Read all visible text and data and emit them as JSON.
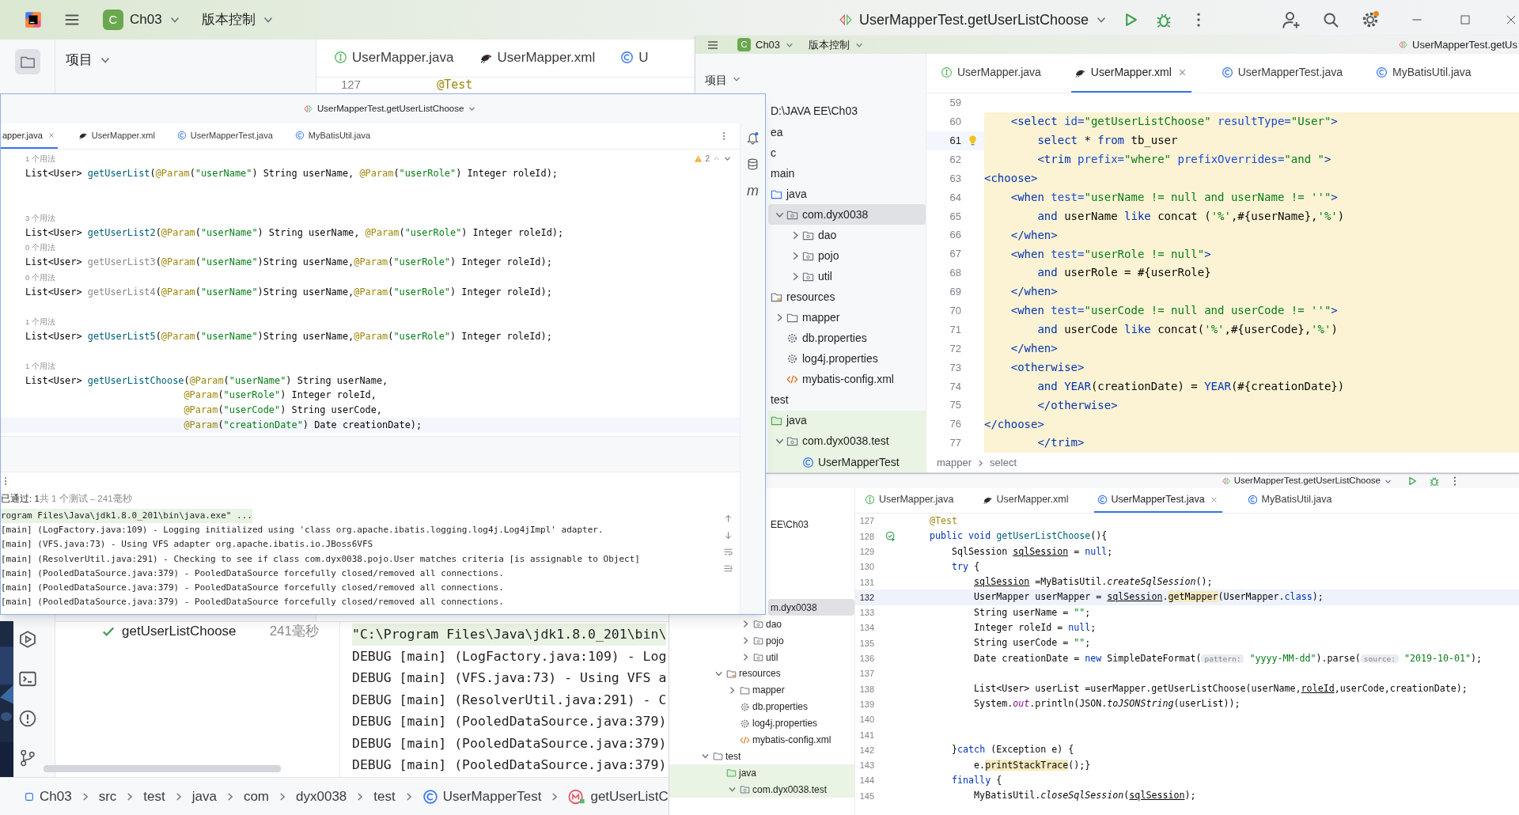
{
  "main_window": {
    "toolbar": {
      "project_badge": "C",
      "project": "Ch03",
      "vcs": "版本控制",
      "run_config": "UserMapperTest.getUserListChoose"
    },
    "project_panel": {
      "title": "项目"
    },
    "tabs": [
      {
        "label": "UserMapper.java",
        "kind": "interface",
        "selected": false
      },
      {
        "label": "UserMapper.xml",
        "kind": "xml",
        "selected": false
      },
      {
        "label": "U",
        "kind": "class",
        "selected": false
      }
    ],
    "lines": [
      {
        "number": "127",
        "current": false,
        "segs": [
          {
            "text": "    @Test",
            "kind": "a"
          }
        ]
      }
    ],
    "test_tree": [
      {
        "name": "getUserListChoose",
        "passed": true,
        "time": "241毫秒"
      }
    ],
    "console": [
      {
        "kind": "command",
        "text": "\"C:\\Program Files\\Java\\jdk1.8.0_201\\bin\\"
      },
      {
        "kind": "log",
        "text": "DEBUG [main] (LogFactory.java:109) - Log"
      },
      {
        "kind": "log",
        "text": "DEBUG [main] (VFS.java:73) - Using VFS a"
      },
      {
        "kind": "log",
        "text": "DEBUG [main] (ResolverUtil.java:291) - C"
      },
      {
        "kind": "log",
        "text": "DEBUG [main] (PooledDataSource.java:379)"
      },
      {
        "kind": "log",
        "text": "DEBUG [main] (PooledDataSource.java:379)"
      },
      {
        "kind": "log",
        "text": "DEBUG [main] (PooledDataSource.java:379)"
      }
    ],
    "breadcrumbs": [
      {
        "label": "Ch03",
        "kind": "module"
      },
      {
        "label": "src",
        "kind": "plain"
      },
      {
        "label": "test",
        "kind": "plain"
      },
      {
        "label": "java",
        "kind": "plain"
      },
      {
        "label": "com",
        "kind": "plain"
      },
      {
        "label": "dyx0038",
        "kind": "plain"
      },
      {
        "label": "test",
        "kind": "plain"
      },
      {
        "label": "UserMapperTest",
        "kind": "class"
      },
      {
        "label": "getUserListC",
        "kind": "method"
      }
    ]
  },
  "editor_window_left": {
    "run_config": "UserMapperTest.getUserListChoose",
    "tabs": [
      {
        "label": "apper.java",
        "kind": "none",
        "selected": true
      },
      {
        "label": "UserMapper.xml",
        "kind": "xml",
        "selected": false
      },
      {
        "label": "UserMapperTest.java",
        "kind": "class",
        "selected": false
      },
      {
        "label": "MyBatisUtil.java",
        "kind": "class",
        "selected": false
      }
    ],
    "inspections": "2",
    "maven_glyph": "m",
    "lines": [
      {
        "kind": "hint",
        "text": "1 个用法"
      },
      {
        "kind": "code",
        "current": false,
        "segs": [
          {
            "text": "List<User> ",
            "kind": "p"
          },
          {
            "text": "getUserList",
            "kind": "m"
          },
          {
            "text": "(",
            "kind": "p"
          },
          {
            "text": "@Param",
            "kind": "a"
          },
          {
            "text": "(",
            "kind": "p"
          },
          {
            "text": "\"userName\"",
            "kind": "s"
          },
          {
            "text": ") String userName, ",
            "kind": "p"
          },
          {
            "text": "@Param",
            "kind": "a"
          },
          {
            "text": "(",
            "kind": "p"
          },
          {
            "text": "\"userRole\"",
            "kind": "s"
          },
          {
            "text": ") Integer roleId);",
            "kind": "p"
          }
        ]
      },
      {
        "kind": "blank"
      },
      {
        "kind": "blank"
      },
      {
        "kind": "hint",
        "text": "3 个用法"
      },
      {
        "kind": "code",
        "current": false,
        "segs": [
          {
            "text": "List<User> ",
            "kind": "p"
          },
          {
            "text": "getUserList2",
            "kind": "m"
          },
          {
            "text": "(",
            "kind": "p"
          },
          {
            "text": "@Param",
            "kind": "a"
          },
          {
            "text": "(",
            "kind": "p"
          },
          {
            "text": "\"userName\"",
            "kind": "s"
          },
          {
            "text": ") String userName, ",
            "kind": "p"
          },
          {
            "text": "@Param",
            "kind": "a"
          },
          {
            "text": "(",
            "kind": "p"
          },
          {
            "text": "\"userRole\"",
            "kind": "s"
          },
          {
            "text": ") Integer roleId);",
            "kind": "p"
          }
        ]
      },
      {
        "kind": "hint",
        "text": "0 个用法"
      },
      {
        "kind": "code",
        "current": false,
        "segs": [
          {
            "text": "List<User> ",
            "kind": "p"
          },
          {
            "text": "getUserList3",
            "kind": "u"
          },
          {
            "text": "(",
            "kind": "p"
          },
          {
            "text": "@Param",
            "kind": "a"
          },
          {
            "text": "(",
            "kind": "p"
          },
          {
            "text": "\"userName\"",
            "kind": "s"
          },
          {
            "text": ")String userName,",
            "kind": "p"
          },
          {
            "text": "@Param",
            "kind": "a"
          },
          {
            "text": "(",
            "kind": "p"
          },
          {
            "text": "\"userRole\"",
            "kind": "s"
          },
          {
            "text": ") Integer roleId);",
            "kind": "p"
          }
        ]
      },
      {
        "kind": "hint",
        "text": "0 个用法"
      },
      {
        "kind": "code",
        "current": false,
        "segs": [
          {
            "text": "List<User> ",
            "kind": "p"
          },
          {
            "text": "getUserList4",
            "kind": "u"
          },
          {
            "text": "(",
            "kind": "p"
          },
          {
            "text": "@Param",
            "kind": "a"
          },
          {
            "text": "(",
            "kind": "p"
          },
          {
            "text": "\"userName\"",
            "kind": "s"
          },
          {
            "text": ")String userName,",
            "kind": "p"
          },
          {
            "text": "@Param",
            "kind": "a"
          },
          {
            "text": "(",
            "kind": "p"
          },
          {
            "text": "\"userRole\"",
            "kind": "s"
          },
          {
            "text": ") Integer roleId);",
            "kind": "p"
          }
        ]
      },
      {
        "kind": "blank"
      },
      {
        "kind": "hint",
        "text": "1 个用法"
      },
      {
        "kind": "code",
        "current": false,
        "segs": [
          {
            "text": "List<User> ",
            "kind": "p"
          },
          {
            "text": "getUserList5",
            "kind": "m"
          },
          {
            "text": "(",
            "kind": "p"
          },
          {
            "text": "@Param",
            "kind": "a"
          },
          {
            "text": "(",
            "kind": "p"
          },
          {
            "text": "\"userName\"",
            "kind": "s"
          },
          {
            "text": ")String userName,",
            "kind": "p"
          },
          {
            "text": "@Param",
            "kind": "a"
          },
          {
            "text": "(",
            "kind": "p"
          },
          {
            "text": "\"userRole\"",
            "kind": "s"
          },
          {
            "text": ") Integer roleId);",
            "kind": "p"
          }
        ]
      },
      {
        "kind": "blank"
      },
      {
        "kind": "hint",
        "text": "1 个用法"
      },
      {
        "kind": "code",
        "current": false,
        "segs": [
          {
            "text": "List<User> ",
            "kind": "p"
          },
          {
            "text": "getUserListChoose",
            "kind": "m"
          },
          {
            "text": "(",
            "kind": "p"
          },
          {
            "text": "@Param",
            "kind": "a"
          },
          {
            "text": "(",
            "kind": "p"
          },
          {
            "text": "\"userName\"",
            "kind": "s"
          },
          {
            "text": ") String userName,",
            "kind": "p"
          }
        ]
      },
      {
        "kind": "code",
        "current": false,
        "segs": [
          {
            "text": "                            @Param",
            "kind": "a"
          },
          {
            "text": "(",
            "kind": "p"
          },
          {
            "text": "\"userRole\"",
            "kind": "s"
          },
          {
            "text": ") Integer roleId,",
            "kind": "p"
          }
        ]
      },
      {
        "kind": "code",
        "current": false,
        "segs": [
          {
            "text": "                            @Param",
            "kind": "a"
          },
          {
            "text": "(",
            "kind": "p"
          },
          {
            "text": "\"userCode\"",
            "kind": "s"
          },
          {
            "text": ") String userCode,",
            "kind": "p"
          }
        ]
      },
      {
        "kind": "code",
        "current": true,
        "segs": [
          {
            "text": "                            @Param",
            "kind": "a"
          },
          {
            "text": "(",
            "kind": "p"
          },
          {
            "text": "\"creationDate\"",
            "kind": "s"
          },
          {
            "text": ") Date creationDate);",
            "kind": "p"
          }
        ]
      }
    ],
    "test_status": {
      "passed": "已通过: 1",
      "summary": "共 1 个测试 – 241毫秒"
    },
    "console": [
      {
        "kind": "command",
        "text": "rogram Files\\Java\\jdk1.8.0_201\\bin\\java.exe\" ..."
      },
      {
        "kind": "log",
        "text": "[main] (LogFactory.java:109) - Logging initialized using 'class org.apache.ibatis.logging.log4j.Log4jImpl' adapter."
      },
      {
        "kind": "log",
        "text": "[main] (VFS.java:73) - Using VFS adapter org.apache.ibatis.io.JBoss6VFS"
      },
      {
        "kind": "log",
        "text": "[main] (ResolverUtil.java:291) - Checking to see if class com.dyx0038.pojo.User matches criteria [is assignable to Object]"
      },
      {
        "kind": "log",
        "text": "[main] (PooledDataSource.java:379) - PooledDataSource forcefully closed/removed all connections."
      },
      {
        "kind": "log",
        "text": "[main] (PooledDataSource.java:379) - PooledDataSource forcefully closed/removed all connections."
      },
      {
        "kind": "log",
        "text": "[main] (PooledDataSource.java:379) - PooledDataSource forcefully closed/removed all connections."
      }
    ]
  },
  "editor_window_right": {
    "toolbar": {
      "project_badge": "C",
      "project": "Ch03",
      "vcs": "版本控制",
      "run_config": "UserMapperTest.getUs"
    },
    "project_panel": {
      "title": "项目"
    },
    "tree": [
      {
        "label": "D:\\JAVA EE\\Ch03",
        "selected": false,
        "children": [
          {
            "label": "ea",
            "selected": false
          },
          {
            "label": "c",
            "selected": false,
            "children": [
              {
                "label": "main",
                "selected": false,
                "children": [
                  {
                    "label": "java",
                    "kind": "source",
                    "selected": false,
                    "children": [
                      {
                        "label": "com.dyx0038",
                        "kind": "package",
                        "selected": true,
                        "expanded": true,
                        "children": [
                          {
                            "label": "dao",
                            "kind": "package",
                            "selected": false,
                            "expanded": false
                          },
                          {
                            "label": "pojo",
                            "kind": "package",
                            "selected": false,
                            "expanded": false
                          },
                          {
                            "label": "util",
                            "kind": "package",
                            "selected": false,
                            "expanded": false
                          }
                        ]
                      }
                    ]
                  },
                  {
                    "label": "resources",
                    "kind": "resources",
                    "selected": false,
                    "children": [
                      {
                        "label": "mapper",
                        "kind": "folder",
                        "selected": false,
                        "expanded": false
                      },
                      {
                        "label": "db.properties",
                        "kind": "properties",
                        "selected": false
                      },
                      {
                        "label": "log4j.properties",
                        "kind": "properties",
                        "selected": false
                      },
                      {
                        "label": "mybatis-config.xml",
                        "kind": "xml",
                        "selected": false
                      }
                    ]
                  }
                ]
              },
              {
                "label": "test",
                "selected": false,
                "children": [
                  {
                    "label": "java",
                    "kind": "test_source",
                    "selected": false,
                    "children": [
                      {
                        "label": "com.dyx0038.test",
                        "kind": "package",
                        "selected": false,
                        "expanded": true,
                        "children": [
                          {
                            "label": "UserMapperTest",
                            "kind": "class",
                            "selected": false
                          }
                        ]
                      }
                    ]
                  }
                ]
              }
            ]
          }
        ]
      }
    ],
    "tabs": [
      {
        "label": "UserMapper.java",
        "kind": "interface",
        "selected": false
      },
      {
        "label": "UserMapper.xml",
        "kind": "xml",
        "selected": true
      },
      {
        "label": "UserMapperTest.java",
        "kind": "class",
        "selected": false
      },
      {
        "label": "MyBatisUtil.java",
        "kind": "class",
        "selected": false
      }
    ],
    "lines": [
      {
        "number": "59",
        "current": false,
        "highlighted": false
      },
      {
        "number": "60",
        "current": false,
        "highlighted": true,
        "segs": [
          {
            "text": "    <select",
            "kind": "x"
          },
          {
            "text": " id=",
            "kind": "n"
          },
          {
            "text": "\"getUserListChoose\"",
            "kind": "s"
          },
          {
            "text": " resultType=",
            "kind": "n"
          },
          {
            "text": "\"User\"",
            "kind": "s"
          },
          {
            "text": ">",
            "kind": "x"
          }
        ]
      },
      {
        "number": "61",
        "current": true,
        "highlighted": true,
        "gutter": {
          "kind": "bulb"
        },
        "segs": [
          {
            "text": "        select",
            "kind": "k"
          },
          {
            "text": " * ",
            "kind": "p"
          },
          {
            "text": "from",
            "kind": "k"
          },
          {
            "text": " tb_user",
            "kind": "p"
          }
        ]
      },
      {
        "number": "62",
        "current": false,
        "highlighted": true,
        "segs": [
          {
            "text": "        <trim",
            "kind": "x"
          },
          {
            "text": " prefix=",
            "kind": "n"
          },
          {
            "text": "\"where\"",
            "kind": "s"
          },
          {
            "text": " prefixOverrides=",
            "kind": "n"
          },
          {
            "text": "\"and \"",
            "kind": "s"
          },
          {
            "text": ">",
            "kind": "x"
          }
        ]
      },
      {
        "number": "63",
        "current": false,
        "highlighted": true,
        "segs": [
          {
            "text": "<choose>",
            "kind": "x"
          }
        ]
      },
      {
        "number": "64",
        "current": false,
        "highlighted": true,
        "segs": [
          {
            "text": "    <when",
            "kind": "x"
          },
          {
            "text": " test=",
            "kind": "n"
          },
          {
            "text": "\"userName != null and userName != ''\"",
            "kind": "s"
          },
          {
            "text": ">",
            "kind": "x"
          }
        ]
      },
      {
        "number": "65",
        "current": false,
        "highlighted": true,
        "segs": [
          {
            "text": "        and",
            "kind": "k"
          },
          {
            "text": " userName ",
            "kind": "p"
          },
          {
            "text": "like",
            "kind": "k"
          },
          {
            "text": " concat (",
            "kind": "p"
          },
          {
            "text": "'%'",
            "kind": "s"
          },
          {
            "text": ",#{userName},",
            "kind": "p"
          },
          {
            "text": "'%'",
            "kind": "s"
          },
          {
            "text": ")",
            "kind": "p"
          }
        ]
      },
      {
        "number": "66",
        "current": false,
        "highlighted": true,
        "segs": [
          {
            "text": "    </when>",
            "kind": "x"
          }
        ]
      },
      {
        "number": "67",
        "current": false,
        "highlighted": true,
        "segs": [
          {
            "text": "    <when",
            "kind": "x"
          },
          {
            "text": " test=",
            "kind": "n"
          },
          {
            "text": "\"userRole != null\"",
            "kind": "s"
          },
          {
            "text": ">",
            "kind": "x"
          }
        ]
      },
      {
        "number": "68",
        "current": false,
        "highlighted": true,
        "segs": [
          {
            "text": "        and",
            "kind": "k"
          },
          {
            "text": " userRole = #{userRole}",
            "kind": "p"
          }
        ]
      },
      {
        "number": "69",
        "current": false,
        "highlighted": true,
        "segs": [
          {
            "text": "    </when>",
            "kind": "x"
          }
        ]
      },
      {
        "number": "70",
        "current": false,
        "highlighted": true,
        "segs": [
          {
            "text": "    <when",
            "kind": "x"
          },
          {
            "text": " test=",
            "kind": "n"
          },
          {
            "text": "\"userCode != null and userCode != ''\"",
            "kind": "s"
          },
          {
            "text": ">",
            "kind": "x"
          }
        ]
      },
      {
        "number": "71",
        "current": false,
        "highlighted": true,
        "segs": [
          {
            "text": "        and",
            "kind": "k"
          },
          {
            "text": " userCode ",
            "kind": "p"
          },
          {
            "text": "like",
            "kind": "k"
          },
          {
            "text": " concat(",
            "kind": "p"
          },
          {
            "text": "'%'",
            "kind": "s"
          },
          {
            "text": ",#{userCode},",
            "kind": "p"
          },
          {
            "text": "'%'",
            "kind": "s"
          },
          {
            "text": ")",
            "kind": "p"
          }
        ]
      },
      {
        "number": "72",
        "current": false,
        "highlighted": true,
        "segs": [
          {
            "text": "    </when>",
            "kind": "x"
          }
        ]
      },
      {
        "number": "73",
        "current": false,
        "highlighted": true,
        "segs": [
          {
            "text": "    <otherwise>",
            "kind": "x"
          }
        ]
      },
      {
        "number": "74",
        "current": false,
        "highlighted": true,
        "segs": [
          {
            "text": "        and",
            "kind": "k"
          },
          {
            "text": " YEAR",
            "kind": "k"
          },
          {
            "text": "(creationDate) = ",
            "kind": "p"
          },
          {
            "text": "YEAR",
            "kind": "k"
          },
          {
            "text": "(#{creationDate})",
            "kind": "p"
          }
        ]
      },
      {
        "number": "75",
        "current": false,
        "highlighted": true,
        "segs": [
          {
            "text": "        </otherwise>",
            "kind": "x"
          }
        ]
      },
      {
        "number": "76",
        "current": false,
        "highlighted": true,
        "segs": [
          {
            "text": "</choose>",
            "kind": "x"
          }
        ]
      },
      {
        "number": "77",
        "current": false,
        "highlighted": true,
        "segs": [
          {
            "text": "        </trim>",
            "kind": "x"
          }
        ]
      }
    ],
    "breadcrumbs": [
      {
        "label": "mapper"
      },
      {
        "label": "select"
      }
    ]
  },
  "editor_window_bottom": {
    "run_config": "UserMapperTest.getUserListChoose",
    "tree": [
      {
        "label": "EE\\Ch03",
        "selected": false,
        "children": [
          {
            "children": [
              {
                "children": [
                  {
                    "children": [
                      {
                        "label": "m.dyx0038",
                        "kind": "package",
                        "selected": true,
                        "children": [
                          {
                            "label": "dao",
                            "kind": "package",
                            "selected": false,
                            "expanded": false
                          },
                          {
                            "label": "pojo",
                            "kind": "package",
                            "selected": false,
                            "expanded": false
                          },
                          {
                            "label": "util",
                            "kind": "package",
                            "selected": false,
                            "expanded": false
                          }
                        ]
                      }
                    ]
                  },
                  {
                    "label": "resources",
                    "kind": "resources",
                    "selected": false,
                    "expanded": true,
                    "children": [
                      {
                        "label": "mapper",
                        "kind": "folder",
                        "selected": false,
                        "expanded": false
                      },
                      {
                        "label": "db.properties",
                        "kind": "properties",
                        "selected": false
                      },
                      {
                        "label": "log4j.properties",
                        "kind": "properties",
                        "selected": false
                      },
                      {
                        "label": "mybatis-config.xml",
                        "kind": "xml",
                        "selected": false
                      }
                    ]
                  }
                ]
              },
              {
                "label": "test",
                "kind": "folder",
                "selected": false,
                "expanded": true,
                "children": [
                  {
                    "label": "java",
                    "kind": "test_source",
                    "selected": false,
                    "children": [
                      {
                        "label": "com.dyx0038.test",
                        "kind": "package",
                        "selected": false,
                        "expanded": true
                      }
                    ]
                  }
                ]
              }
            ]
          }
        ]
      }
    ],
    "tabs": [
      {
        "label": "UserMapper.java",
        "kind": "interface",
        "selected": false
      },
      {
        "label": "UserMapper.xml",
        "kind": "xml",
        "selected": false
      },
      {
        "label": "UserMapperTest.java",
        "kind": "class",
        "selected": true
      },
      {
        "label": "MyBatisUtil.java",
        "kind": "class",
        "selected": false
      }
    ],
    "lines": [
      {
        "number": "127",
        "current": false,
        "segs": [
          {
            "text": "    @Test",
            "kind": "a"
          }
        ]
      },
      {
        "number": "128",
        "current": false,
        "gutter": {
          "kind": "run_test"
        },
        "segs": [
          {
            "text": "    public void ",
            "kind": "k"
          },
          {
            "text": "getUserListChoose",
            "kind": "m"
          },
          {
            "text": "(){",
            "kind": "p"
          }
        ]
      },
      {
        "number": "129",
        "current": false,
        "segs": [
          {
            "text": "        SqlSession ",
            "kind": "p"
          },
          {
            "text": "sqlSession",
            "kind": "ul"
          },
          {
            "text": " = ",
            "kind": "p"
          },
          {
            "text": "null",
            "kind": "k"
          },
          {
            "text": ";",
            "kind": "p"
          }
        ]
      },
      {
        "number": "130",
        "current": false,
        "segs": [
          {
            "text": "        try",
            "kind": "k"
          },
          {
            "text": " {",
            "kind": "p"
          }
        ]
      },
      {
        "number": "131",
        "current": false,
        "segs": [
          {
            "text": "            sqlSession",
            "kind": "ul"
          },
          {
            "text": " =MyBatisUtil.",
            "kind": "p"
          },
          {
            "text": "createSqlSession",
            "kind": "it"
          },
          {
            "text": "();",
            "kind": "p"
          }
        ]
      },
      {
        "number": "132",
        "current": true,
        "segs": [
          {
            "text": "            UserMapper userMapper = ",
            "kind": "p"
          },
          {
            "text": "sqlSession",
            "kind": "ul"
          },
          {
            "text": ".",
            "kind": "p"
          },
          {
            "text": "getMapper",
            "kind": "hl"
          },
          {
            "text": "(UserMapper.",
            "kind": "p"
          },
          {
            "text": "class",
            "kind": "k"
          },
          {
            "text": ");",
            "kind": "p"
          }
        ]
      },
      {
        "number": "133",
        "current": false,
        "segs": [
          {
            "text": "            String userName = ",
            "kind": "p"
          },
          {
            "text": "\"\"",
            "kind": "s"
          },
          {
            "text": ";",
            "kind": "p"
          }
        ]
      },
      {
        "number": "134",
        "current": false,
        "segs": [
          {
            "text": "            Integer roleId = ",
            "kind": "p"
          },
          {
            "text": "null",
            "kind": "k"
          },
          {
            "text": ";",
            "kind": "p"
          }
        ]
      },
      {
        "number": "135",
        "current": false,
        "segs": [
          {
            "text": "            String userCode = ",
            "kind": "p"
          },
          {
            "text": "\"\"",
            "kind": "s"
          },
          {
            "text": ";",
            "kind": "p"
          }
        ]
      },
      {
        "number": "136",
        "current": false,
        "segs": [
          {
            "text": "            Date creationDate = ",
            "kind": "p"
          },
          {
            "text": "new",
            "kind": "k"
          },
          {
            "text": " SimpleDateFormat(",
            "kind": "p"
          },
          {
            "text": "pattern:",
            "kind": "h"
          },
          {
            "text": " \"yyyy-MM-dd\"",
            "kind": "s"
          },
          {
            "text": ").parse(",
            "kind": "p"
          },
          {
            "text": "source:",
            "kind": "h"
          },
          {
            "text": " \"2019-10-01\"",
            "kind": "s"
          },
          {
            "text": ");",
            "kind": "p"
          }
        ]
      },
      {
        "number": "137",
        "current": false
      },
      {
        "number": "138",
        "current": false,
        "segs": [
          {
            "text": "            List<User> userList =userMapper.getUserListChoose(userName,",
            "kind": "p"
          },
          {
            "text": "roleId",
            "kind": "ul"
          },
          {
            "text": ",userCode,creationDate);",
            "kind": "p"
          }
        ]
      },
      {
        "number": "139",
        "current": false,
        "segs": [
          {
            "text": "            System.",
            "kind": "p"
          },
          {
            "text": "out",
            "kind": "f"
          },
          {
            "text": ".println(JSON.",
            "kind": "p"
          },
          {
            "text": "toJSONString",
            "kind": "it"
          },
          {
            "text": "(userList));",
            "kind": "p"
          }
        ]
      },
      {
        "number": "140",
        "current": false
      },
      {
        "number": "141",
        "current": false
      },
      {
        "number": "142",
        "current": false,
        "segs": [
          {
            "text": "        }",
            "kind": "p"
          },
          {
            "text": "catch",
            "kind": "k"
          },
          {
            "text": " (Exception e) {",
            "kind": "p"
          }
        ]
      },
      {
        "number": "143",
        "current": false,
        "segs": [
          {
            "text": "            e.",
            "kind": "p"
          },
          {
            "text": "printStackTrace",
            "kind": "hl"
          },
          {
            "text": "();}",
            "kind": "p"
          }
        ]
      },
      {
        "number": "144",
        "current": false,
        "segs": [
          {
            "text": "        finally",
            "kind": "k"
          },
          {
            "text": " {",
            "kind": "p"
          }
        ]
      },
      {
        "number": "145",
        "current": false,
        "segs": [
          {
            "text": "            MyBatisUtil.",
            "kind": "p"
          },
          {
            "text": "closeSqlSession",
            "kind": "it"
          },
          {
            "text": "(",
            "kind": "p"
          },
          {
            "text": "sqlSession",
            "kind": "ul"
          },
          {
            "text": ");",
            "kind": "p"
          }
        ]
      }
    ]
  }
}
